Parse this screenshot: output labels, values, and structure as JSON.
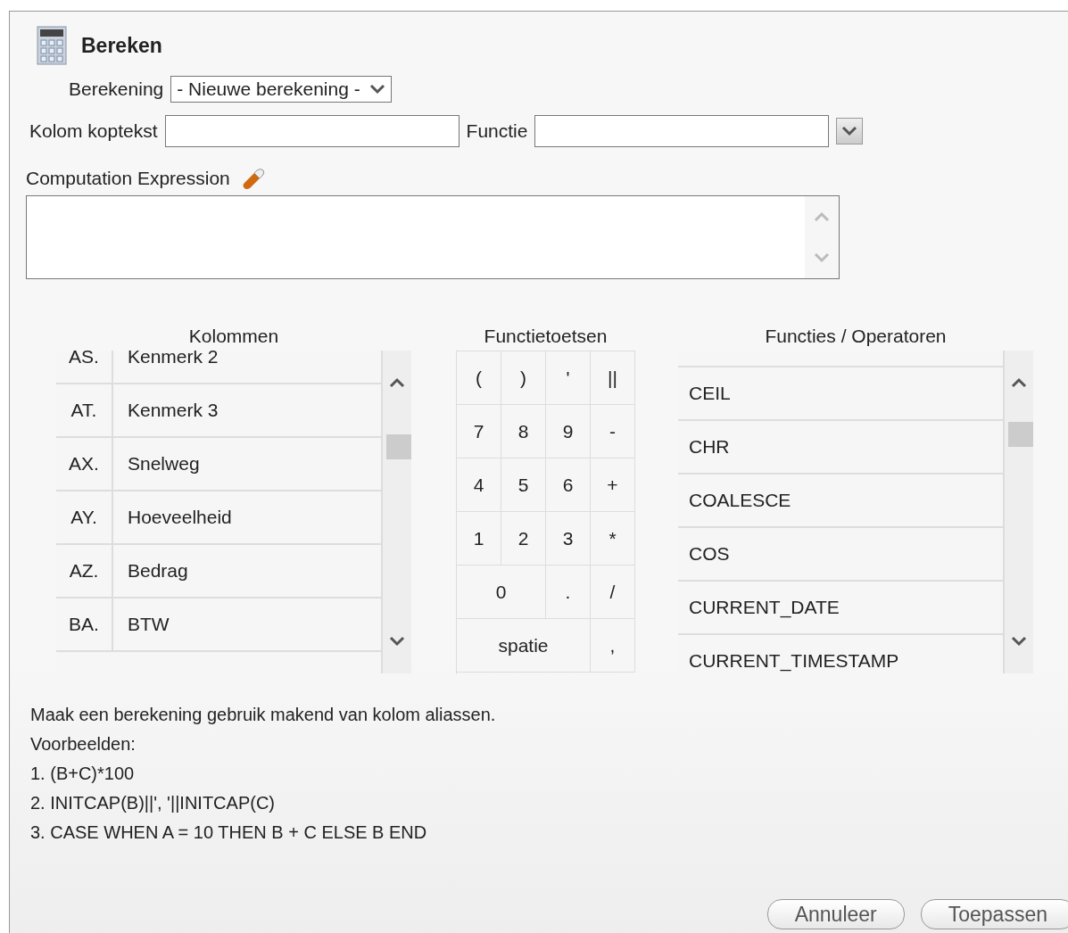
{
  "title": "Bereken",
  "berekening": {
    "label": "Berekening",
    "value": "- Nieuwe berekening -"
  },
  "kolom_koptekst": {
    "label": "Kolom koptekst"
  },
  "functie": {
    "label": "Functie"
  },
  "expression": {
    "label": "Computation Expression"
  },
  "kolommen": {
    "title": "Kolommen",
    "rows": [
      {
        "alias": "AS.",
        "name": "Kenmerk 2"
      },
      {
        "alias": "AT.",
        "name": "Kenmerk 3"
      },
      {
        "alias": "AX.",
        "name": "Snelweg"
      },
      {
        "alias": "AY.",
        "name": "Hoeveelheid"
      },
      {
        "alias": "AZ.",
        "name": "Bedrag"
      },
      {
        "alias": "BA.",
        "name": "BTW"
      }
    ]
  },
  "functietoetsen": {
    "title": "Functietoetsen",
    "keys": [
      {
        "label": "(",
        "kind": "single"
      },
      {
        "label": ")",
        "kind": "single"
      },
      {
        "label": "'",
        "kind": "single"
      },
      {
        "label": "||",
        "kind": "single"
      },
      {
        "label": "7",
        "kind": "single"
      },
      {
        "label": "8",
        "kind": "single"
      },
      {
        "label": "9",
        "kind": "single"
      },
      {
        "label": "-",
        "kind": "single"
      },
      {
        "label": "4",
        "kind": "single"
      },
      {
        "label": "5",
        "kind": "single"
      },
      {
        "label": "6",
        "kind": "single"
      },
      {
        "label": "+",
        "kind": "single"
      },
      {
        "label": "1",
        "kind": "single"
      },
      {
        "label": "2",
        "kind": "single"
      },
      {
        "label": "3",
        "kind": "single"
      },
      {
        "label": "*",
        "kind": "single"
      },
      {
        "label": "0",
        "kind": "double"
      },
      {
        "label": ".",
        "kind": "single"
      },
      {
        "label": "/",
        "kind": "single"
      },
      {
        "label": "spatie",
        "kind": "triple"
      },
      {
        "label": ",",
        "kind": "single"
      }
    ]
  },
  "functies": {
    "title": "Functies / Operatoren",
    "items": [
      "CEIL",
      "CHR",
      "COALESCE",
      "COS",
      "CURRENT_DATE",
      "CURRENT_TIMESTAMP"
    ]
  },
  "help": [
    "Maak een berekening gebruik makend van kolom aliassen.",
    "Voorbeelden:",
    "1. (B+C)*100",
    "2. INITCAP(B)||', '||INITCAP(C)",
    "3. CASE WHEN A = 10 THEN B + C ELSE B END"
  ],
  "buttons": [
    "Annuleer",
    "Toepassen"
  ]
}
